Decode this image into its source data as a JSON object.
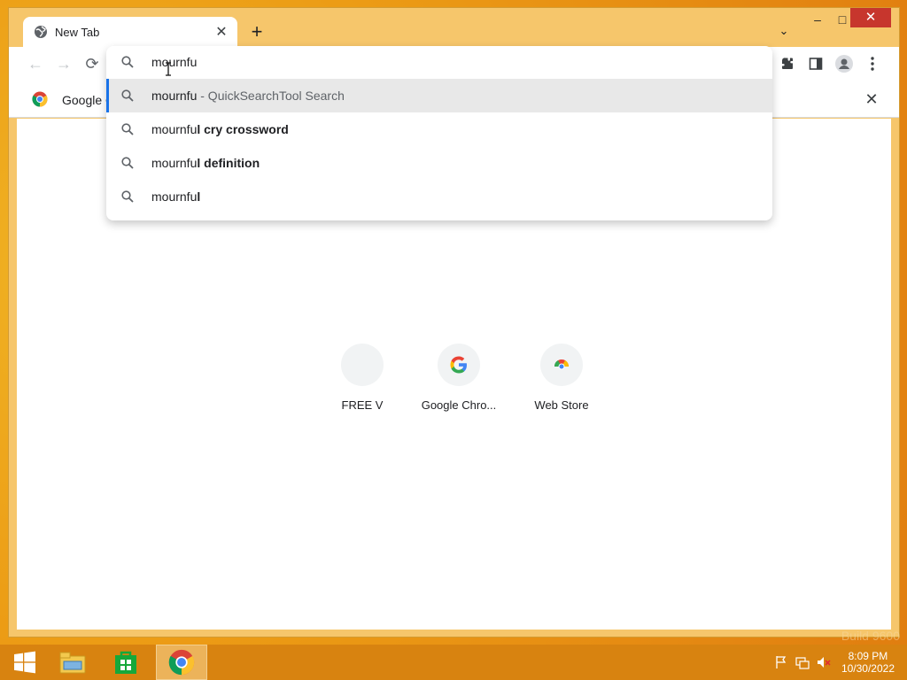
{
  "browser": {
    "tab_title": "New Tab",
    "tab_close": "✕",
    "new_tab": "+",
    "tab_search": "⌄",
    "window_controls": {
      "minimize": "–",
      "maximize": "□",
      "close": "✕"
    },
    "nav": {
      "back": "←",
      "forward": "→",
      "reload": "⟳"
    }
  },
  "bookmark_bar": {
    "text": "Google C",
    "close": "✕"
  },
  "omnibox": {
    "query": "mournfu",
    "suggestions": [
      {
        "prefix": "mournfu",
        "suffix": "",
        "detail": " - QuickSearchTool Search",
        "selected": true
      },
      {
        "prefix": "mournfu",
        "suffix": "l cry crossword",
        "detail": "",
        "selected": false
      },
      {
        "prefix": "mournfu",
        "suffix": "l definition",
        "detail": "",
        "selected": false
      },
      {
        "prefix": "mournfu",
        "suffix": "l",
        "detail": "",
        "selected": false
      }
    ]
  },
  "shortcuts": [
    {
      "label": "FREE V",
      "icon": "blank-icon"
    },
    {
      "label": "Google Chro...",
      "icon": "google-g-icon"
    },
    {
      "label": "Web Store",
      "icon": "web-store-icon"
    }
  ],
  "taskbar": {
    "apps": [
      "start-button",
      "file-explorer-icon",
      "windows-store-icon",
      "chrome-icon"
    ],
    "clock_time": "8:09 PM",
    "clock_date": "10/30/2022"
  },
  "watermark": "Build 9600",
  "colors": {
    "accent": "#1a73e8",
    "window_frame": "#f6c66b",
    "taskbar": "#d88310",
    "close_button": "#c7362d"
  }
}
